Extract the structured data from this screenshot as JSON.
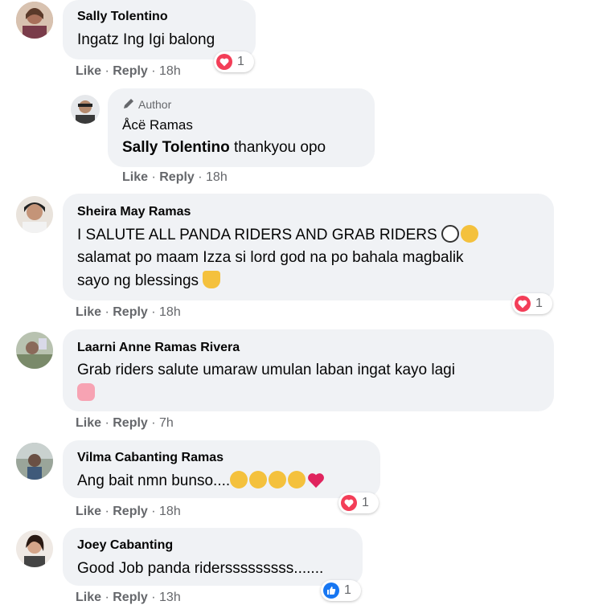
{
  "comments": [
    {
      "name": "Sally Tolentino",
      "text": "Ingatz Ing Igi balong",
      "like": "Like",
      "reply": "Reply",
      "time": "18h",
      "reaction_count": "1"
    },
    {
      "author_tag": "Author",
      "name": "Åcë Ramas",
      "mention": "Sally Tolentino",
      "text": "thankyou opo",
      "like": "Like",
      "reply": "Reply",
      "time": "18h"
    },
    {
      "name": "Sheira May Ramas",
      "line1": "I SALUTE ALL PANDA RIDERS AND GRAB RIDERS",
      "line2": "salamat po maam Izza si lord god na po bahala magbalik",
      "line3": "sayo ng blessings",
      "like": "Like",
      "reply": "Reply",
      "time": "18h",
      "reaction_count": "1"
    },
    {
      "name": "Laarni Anne Ramas Rivera",
      "text": "Grab riders salute umaraw umulan laban ingat kayo lagi",
      "like": "Like",
      "reply": "Reply",
      "time": "7h"
    },
    {
      "name": "Vilma Cabanting Ramas",
      "text": "Ang bait nmn bunso....",
      "like": "Like",
      "reply": "Reply",
      "time": "18h",
      "reaction_count": "1"
    },
    {
      "name": "Joey Cabanting",
      "text": "Good Job panda ridersssssssss.......",
      "like": "Like",
      "reply": "Reply",
      "time": "13h",
      "reaction_count": "1"
    }
  ],
  "separator": " · ",
  "icons": {
    "love": "heart-icon",
    "like": "thumbs-up-icon",
    "author": "pencil-icon"
  },
  "colors": {
    "bubble": "#f0f2f5",
    "love": "#f33e58",
    "like": "#1877f2",
    "meta": "#65676b"
  }
}
